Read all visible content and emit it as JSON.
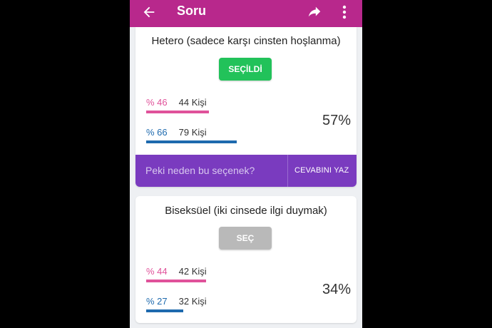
{
  "appbar": {
    "title": "Soru"
  },
  "options": [
    {
      "title": "Hetero (sadece karşı cinsten hoşlanma)",
      "button_label": "SEÇİLDİ",
      "female_pct": "% 46",
      "female_count": "44 Kişi",
      "female_value": 46,
      "male_pct": "% 66",
      "male_count": "79 Kişi",
      "male_value": 66,
      "total": "57%",
      "reason_placeholder": "Peki neden bu seçenek?",
      "reason_cta": "CEVABINI YAZ"
    },
    {
      "title": "Biseksüel (iki cinsede ilgi duymak)",
      "button_label": "SEÇ",
      "female_pct": "% 44",
      "female_count": "42 Kişi",
      "female_value": 44,
      "male_pct": "% 27",
      "male_count": "32 Kişi",
      "male_value": 27,
      "total": "34%"
    }
  ],
  "icons": {
    "back": "arrow-back-icon",
    "share": "share-icon",
    "more": "more-vertical-icon"
  },
  "colors": {
    "appbar": "#b8288c",
    "selected": "#22c25a",
    "unselected": "#b9b9b9",
    "female": "#e0529a",
    "male": "#1e6aae",
    "reason_bar": "#7a3bbf"
  }
}
